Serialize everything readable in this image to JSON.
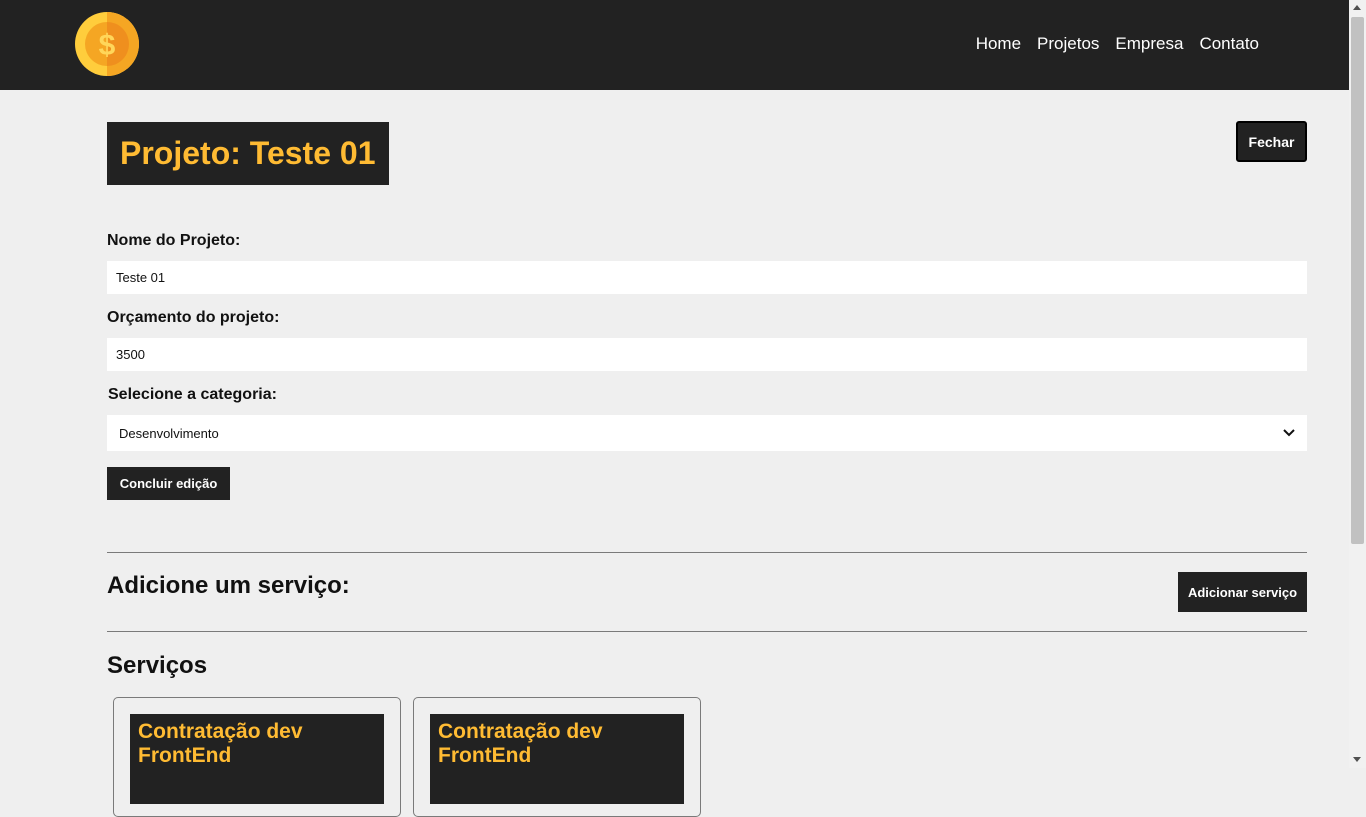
{
  "nav": {
    "logo_icon": "dollar-coin-icon",
    "links": [
      "Home",
      "Projetos",
      "Empresa",
      "Contato"
    ]
  },
  "project": {
    "title": "Projeto: Teste 01",
    "close_label": "Fechar"
  },
  "form": {
    "name_label": "Nome do Projeto:",
    "name_value": "Teste 01",
    "budget_label": "Orçamento do projeto:",
    "budget_value": "3500",
    "category_label": "Selecione a categoria:",
    "category_value": "Desenvolvimento",
    "submit_label": "Concluir edição"
  },
  "services": {
    "add_title": "Adicione um serviço:",
    "add_button": "Adicionar serviço",
    "list_title": "Serviços",
    "cards": [
      {
        "title": "Contratação dev FrontEnd"
      },
      {
        "title": "Contratação dev FrontEnd"
      }
    ]
  },
  "colors": {
    "accent": "#ffbb33",
    "dark": "#222222",
    "background": "#efefef"
  }
}
